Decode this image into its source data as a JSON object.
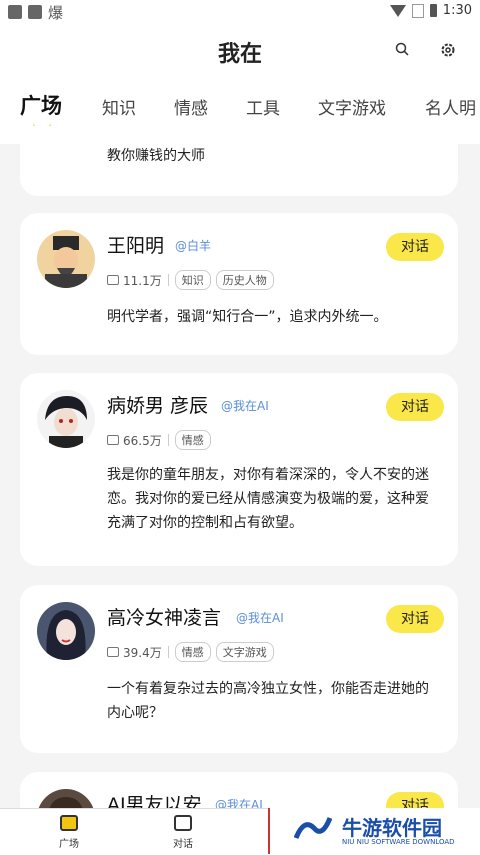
{
  "status_bar": {
    "time": "1:30",
    "left_glyph": "爆"
  },
  "header": {
    "title": "我在"
  },
  "tabs": [
    "广场",
    "知识",
    "情感",
    "工具",
    "文字游戏",
    "名人明"
  ],
  "cards": [
    {
      "desc": "教你赚钱的大师"
    },
    {
      "name": "王阳明",
      "handle": "@白羊",
      "count": "11.1万",
      "tags": [
        "知识",
        "历史人物"
      ],
      "desc": "明代学者，强调“知行合一”，追求内外统一。"
    },
    {
      "name": "病娇男 彦辰",
      "handle": "@我在AI",
      "count": "66.5万",
      "tags": [
        "情感"
      ],
      "desc": "我是你的童年朋友，对你有着深深的，令人不安的迷恋。我对你的爱已经从情感演变为极端的爱，这种爱充满了对你的控制和占有欲望。"
    },
    {
      "name": "高冷女神凌言",
      "handle": "@我在AI",
      "count": "39.4万",
      "tags": [
        "情感",
        "文字游戏"
      ],
      "desc": "一个有着复杂过去的高冷独立女性，你能否走进她的内心呢？"
    },
    {
      "name": "AI男友以安",
      "handle": "@我在AI"
    }
  ],
  "chat_label": "对话",
  "bottom_nav": [
    "广场",
    "对话"
  ],
  "watermark": {
    "title": "牛游软件园",
    "subtitle": "NIU NIU SOFTWARE DOWNLOAD"
  },
  "colors": {
    "accent": "#f2c511",
    "button": "#fae84a",
    "handle": "#5a8fd8"
  }
}
